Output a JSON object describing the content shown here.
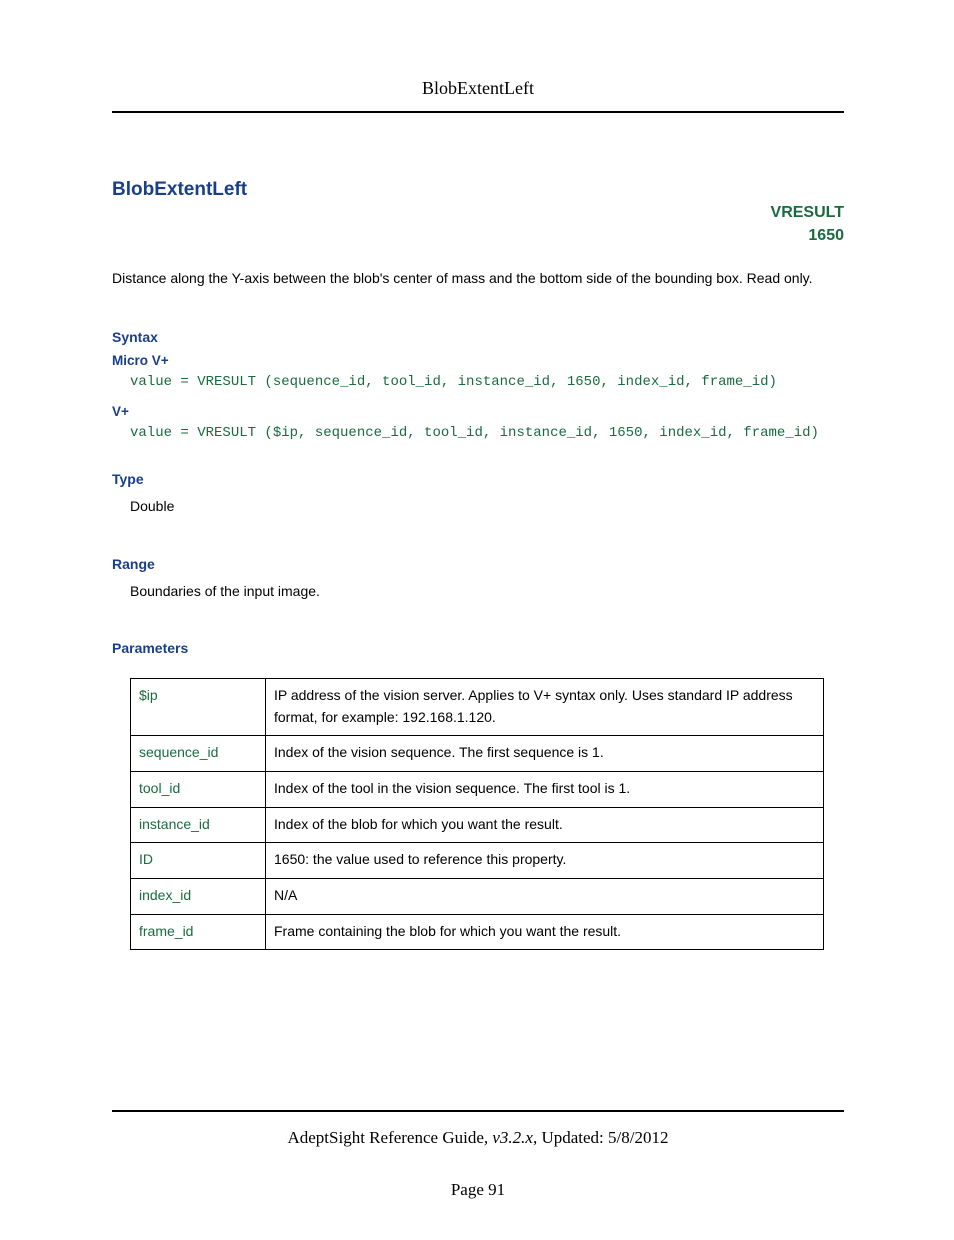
{
  "header": {
    "running_title": "BlobExtentLeft"
  },
  "title": "BlobExtentLeft",
  "vresult": {
    "label": "VRESULT",
    "code": "1650"
  },
  "description": "Distance along the Y-axis between the blob's center of mass and the bottom side of the bounding box. Read only.",
  "syntax": {
    "heading": "Syntax",
    "micro_label": "Micro V+",
    "micro_code": "value = VRESULT (sequence_id, tool_id, instance_id, 1650, index_id, frame_id)",
    "vplus_label": "V+",
    "vplus_code": "value = VRESULT ($ip, sequence_id, tool_id, instance_id, 1650, index_id, frame_id)"
  },
  "type": {
    "heading": "Type",
    "value": "Double"
  },
  "range": {
    "heading": "Range",
    "value": "Boundaries of the input image."
  },
  "parameters": {
    "heading": "Parameters",
    "rows": [
      {
        "name": "$ip",
        "desc": "IP address of the vision server. Applies to V+ syntax only. Uses standard IP address format, for example: 192.168.1.120."
      },
      {
        "name": "sequence_id",
        "desc": "Index of the vision sequence. The first sequence is 1."
      },
      {
        "name": "tool_id",
        "desc": "Index of the tool in the vision sequence. The first tool is 1."
      },
      {
        "name": "instance_id",
        "desc": "Index of the blob for which you want the result."
      },
      {
        "name": "ID",
        "desc": "1650: the value used to reference this property."
      },
      {
        "name": "index_id",
        "desc": "N/A"
      },
      {
        "name": "frame_id",
        "desc": "Frame containing the blob for which you want the result."
      }
    ]
  },
  "footer": {
    "guide": "AdeptSight Reference Guide",
    "version": "v3.2.x",
    "updated_label": "Updated:",
    "updated_date": "5/8/2012",
    "page_label": "Page",
    "page_number": "91"
  }
}
